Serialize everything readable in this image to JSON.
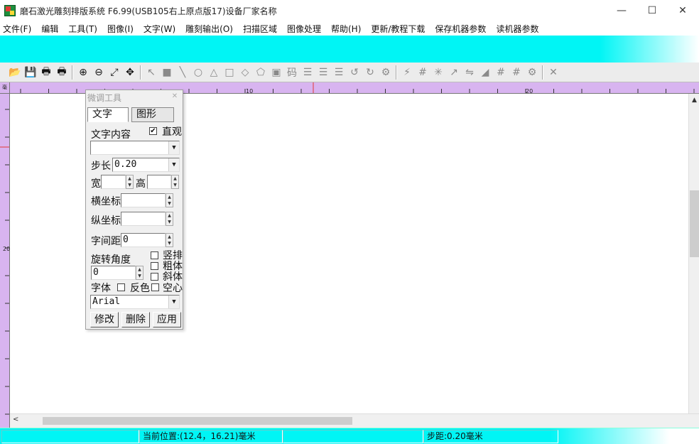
{
  "window": {
    "title": "磨石激光雕刻排版系统 F6.99(USB105右上原点版17)设备厂家名称",
    "minimize": "—",
    "maximize": "☐",
    "close": "✕"
  },
  "menu": [
    "文件(F)",
    "编辑",
    "工具(T)",
    "图像(I)",
    "文字(W)",
    "雕刻输出(O)",
    "扫描区域",
    "图像处理",
    "帮助(H)",
    "更新/教程下载",
    "保存机器参数",
    "读机器参数"
  ],
  "toolbar": [
    {
      "name": "open-icon",
      "glyph": "📂"
    },
    {
      "name": "save-icon",
      "glyph": "💾"
    },
    {
      "name": "print-icon",
      "glyph": "🖶"
    },
    {
      "name": "print-preview-icon",
      "glyph": "🖶"
    },
    {
      "name": "zoom-in-icon",
      "glyph": "⊕"
    },
    {
      "name": "zoom-out-icon",
      "glyph": "⊖"
    },
    {
      "name": "fit-window-icon",
      "glyph": "⤢"
    },
    {
      "name": "move-icon",
      "glyph": "✥"
    },
    {
      "name": "select-arrow-icon",
      "glyph": "↖"
    },
    {
      "name": "rectangle-fill-icon",
      "glyph": "■"
    },
    {
      "name": "line-icon",
      "glyph": "╲"
    },
    {
      "name": "circle-icon",
      "glyph": "○"
    },
    {
      "name": "triangle-icon",
      "glyph": "△"
    },
    {
      "name": "square-icon",
      "glyph": "□"
    },
    {
      "name": "diamond-icon",
      "glyph": "◇"
    },
    {
      "name": "pentagon-icon",
      "glyph": "⬠"
    },
    {
      "name": "image-icon",
      "glyph": "▣"
    },
    {
      "name": "text-tool-icon",
      "glyph": "码"
    },
    {
      "name": "align-left-icon",
      "glyph": "☰"
    },
    {
      "name": "align-center-icon",
      "glyph": "☰"
    },
    {
      "name": "align-right-icon",
      "glyph": "☰"
    },
    {
      "name": "rotate-left-icon",
      "glyph": "↺"
    },
    {
      "name": "rotate-right-icon",
      "glyph": "↻"
    },
    {
      "name": "gear-small-icon",
      "glyph": "⚙"
    },
    {
      "name": "laser-icon",
      "glyph": "⚡"
    },
    {
      "name": "grid-icon",
      "glyph": "#"
    },
    {
      "name": "node-icon",
      "glyph": "✳"
    },
    {
      "name": "curve-icon",
      "glyph": "↗"
    },
    {
      "name": "mirror-icon",
      "glyph": "⇋"
    },
    {
      "name": "eraser-icon",
      "glyph": "◢"
    },
    {
      "name": "hash-icon",
      "glyph": "#"
    },
    {
      "name": "hash-double-icon",
      "glyph": "#"
    },
    {
      "name": "settings-icon",
      "glyph": "⚙"
    },
    {
      "name": "delete-x-icon",
      "glyph": "✕"
    }
  ],
  "rulers": {
    "corner": "毫米",
    "top_labels": [
      {
        "text": "10",
        "at": 10
      },
      {
        "text": "20",
        "at": 20
      }
    ],
    "left_labels": [
      {
        "text": "20",
        "at": 20
      }
    ]
  },
  "panel": {
    "title": "微调工具",
    "close_icon": "✕",
    "tabs": {
      "text": "文字",
      "shape": "图形"
    },
    "text_content_label": "文字内容",
    "direct_checkbox": {
      "label": "直观",
      "checked": true
    },
    "text_content_value": "",
    "step_label": "步长",
    "step_value": "0.20",
    "width_label": "宽",
    "width_value": "",
    "height_label": "高",
    "height_value": "",
    "x_label": "横坐标",
    "x_value": "",
    "y_label": "纵坐标",
    "y_value": "",
    "spacing_label": "字间距",
    "spacing_value": "0",
    "rotation_label": "旋转角度",
    "rotation_value": "0",
    "vertical_label": "竖排",
    "bold_label": "粗体",
    "italic_label": "斜体",
    "font_label": "字体",
    "invert_label": "反色",
    "hollow_label": "空心",
    "font_value": "Arial",
    "buttons": {
      "modify": "修改",
      "delete": "删除",
      "apply": "应用"
    }
  },
  "status": {
    "position": "当前位置:(12.4，16.21)毫米",
    "step": "步距:0.20毫米"
  },
  "scroll": {
    "up": "▲",
    "left": "<"
  },
  "drop_arrow": "▼",
  "spin_up": "▲",
  "spin_down": "▼",
  "check_mark": "✔"
}
